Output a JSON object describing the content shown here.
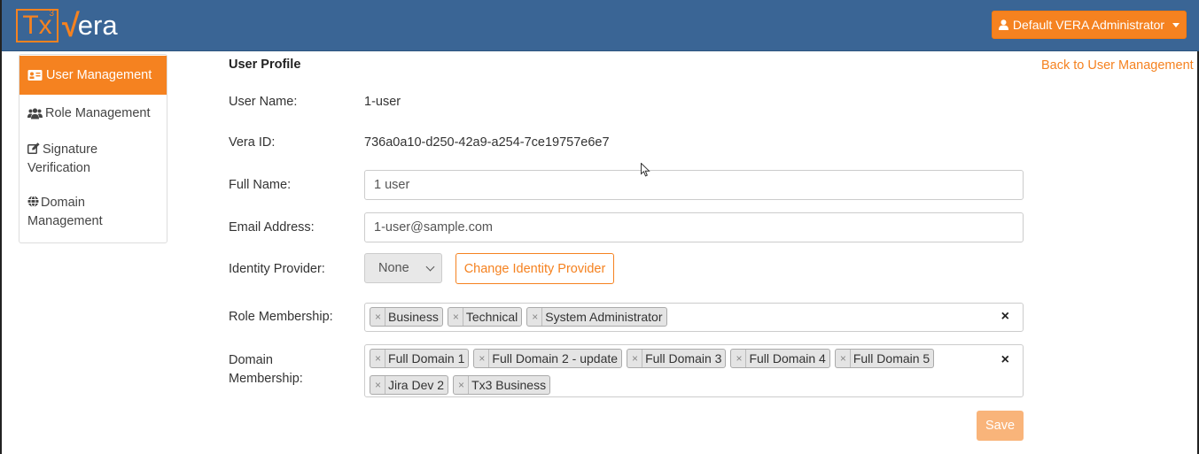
{
  "brand": {
    "logo_tx": "Tx",
    "logo_three": "3",
    "logo_check": "√",
    "logo_era": "era"
  },
  "header": {
    "user_button_label": "Default VERA Administrator"
  },
  "sidebar": {
    "items": [
      {
        "label": "User Management",
        "icon": "id-card-icon",
        "active": true
      },
      {
        "label": "Role Management",
        "icon": "users-icon",
        "active": false
      },
      {
        "label": "Signature Verification",
        "icon": "edit-icon",
        "active": false
      },
      {
        "label": "Domain Management",
        "icon": "globe-icon",
        "active": false
      }
    ]
  },
  "page": {
    "title": "User Profile",
    "back_link": "Back to User Management"
  },
  "form": {
    "user_name_label": "User Name:",
    "user_name_value": "1-user",
    "vera_id_label": "Vera ID:",
    "vera_id_value": "736a0a10-d250-42a9-a254-7ce19757e6e7",
    "full_name_label": "Full Name:",
    "full_name_value": "1 user",
    "email_label": "Email Address:",
    "email_value": "1-user@sample.com",
    "identity_provider_label": "Identity Provider:",
    "identity_provider_value": "None",
    "change_identity_provider_label": "Change Identity Provider",
    "role_membership_label": "Role Membership:",
    "role_membership": [
      "Business",
      "Technical",
      "System Administrator"
    ],
    "domain_membership_label_line1": "Domain",
    "domain_membership_label_line2": "Membership:",
    "domain_membership": [
      "Full Domain 1",
      "Full Domain 2 - update",
      "Full Domain 3",
      "Full Domain 4",
      "Full Domain 5",
      "Jira Dev 2",
      "Tx3 Business"
    ],
    "tag_remove_glyph": "×",
    "clear_glyph": "×",
    "save_label": "Save"
  },
  "colors": {
    "navbar": "#3a6595",
    "accent": "#f58220",
    "save_disabled": "#f9b47a"
  }
}
